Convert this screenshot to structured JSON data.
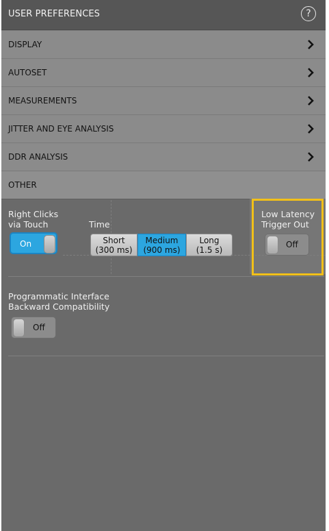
{
  "header": {
    "title": "USER PREFERENCES",
    "help_icon": "help-circle-icon"
  },
  "sections": [
    {
      "label": "DISPLAY",
      "icon": "chevron-right-icon"
    },
    {
      "label": "AUTOSET",
      "icon": "chevron-right-icon"
    },
    {
      "label": "MEASUREMENTS",
      "icon": "chevron-right-icon"
    },
    {
      "label": "JITTER AND EYE ANALYSIS",
      "icon": "chevron-right-icon"
    },
    {
      "label": "DDR ANALYSIS",
      "icon": "chevron-right-icon"
    }
  ],
  "other": {
    "label": "OTHER",
    "right_clicks": {
      "label_line1": "Right Clicks",
      "label_line2": "via Touch",
      "state": "On"
    },
    "time": {
      "label": "Time",
      "options": [
        {
          "line1": "Short",
          "line2": "(300 ms)"
        },
        {
          "line1": "Medium",
          "line2": "(900 ms)"
        },
        {
          "line1": "Long",
          "line2": "(1.5 s)"
        }
      ],
      "selected": "Medium"
    },
    "low_latency": {
      "label_line1": "Low Latency",
      "label_line2": "Trigger Out",
      "state": "Off"
    },
    "programmatic": {
      "label_line1": "Programmatic Interface",
      "label_line2": "Backward Compatibility",
      "state": "Off"
    }
  },
  "colors": {
    "accent": "#2ca6e0",
    "highlight": "#f2c018",
    "panel": "#6a6a6a",
    "row": "#8b8b8b"
  }
}
